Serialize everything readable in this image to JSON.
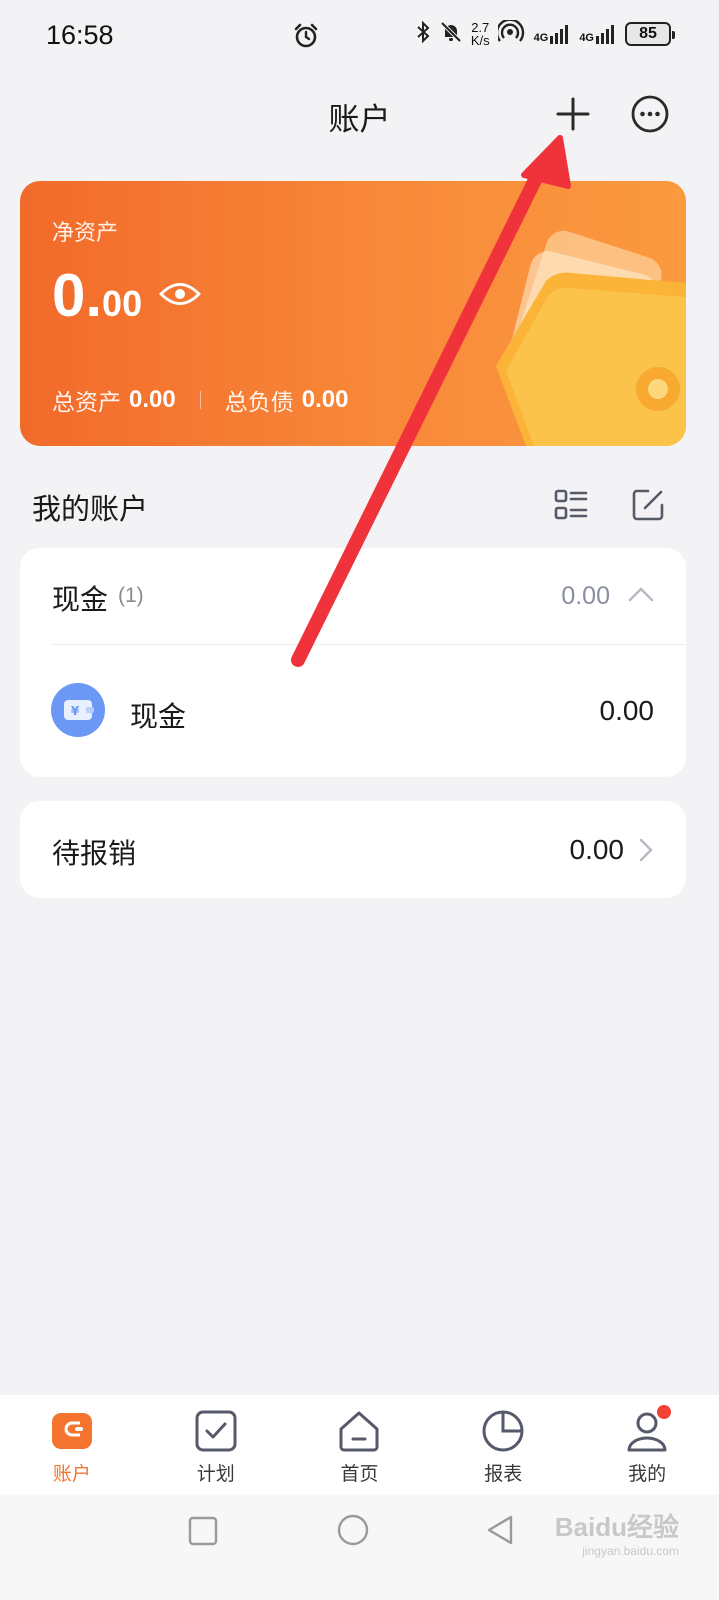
{
  "status_bar": {
    "time": "16:58",
    "speed_value": "2.7",
    "speed_unit": "K/s",
    "network_1": "4G",
    "network_2": "4G",
    "battery": "85"
  },
  "header": {
    "title": "账户"
  },
  "net_assets_card": {
    "label": "净资产",
    "value_int": "0.",
    "value_dec": "00",
    "total_assets_label": "总资产",
    "total_assets_value": "0.00",
    "total_liabilities_label": "总负债",
    "total_liabilities_value": "0.00"
  },
  "my_accounts": {
    "title": "我的账户",
    "groups": [
      {
        "name": "现金",
        "count": "(1)",
        "amount": "0.00",
        "accounts": [
          {
            "name": "现金",
            "amount": "0.00",
            "icon": "cash-wallet-icon"
          }
        ]
      }
    ]
  },
  "reimbursement": {
    "label": "待报销",
    "amount": "0.00"
  },
  "tabbar": {
    "tabs": [
      {
        "label": "账户",
        "icon": "wallet-icon",
        "active": true
      },
      {
        "label": "计划",
        "icon": "checkbox-icon",
        "active": false
      },
      {
        "label": "首页",
        "icon": "home-icon",
        "active": false
      },
      {
        "label": "报表",
        "icon": "pie-chart-icon",
        "active": false
      },
      {
        "label": "我的",
        "icon": "user-icon",
        "active": false,
        "badge": true
      }
    ]
  },
  "watermark": {
    "brand": "Baidu经验",
    "url": "jingyan.baidu.com"
  },
  "colors": {
    "accent": "#f4742f",
    "card_gradient_start": "#f26a2a",
    "card_gradient_end": "#fb9a3f",
    "annotation_arrow": "#f0323a",
    "cash_icon_bg": "#6b97f5"
  }
}
